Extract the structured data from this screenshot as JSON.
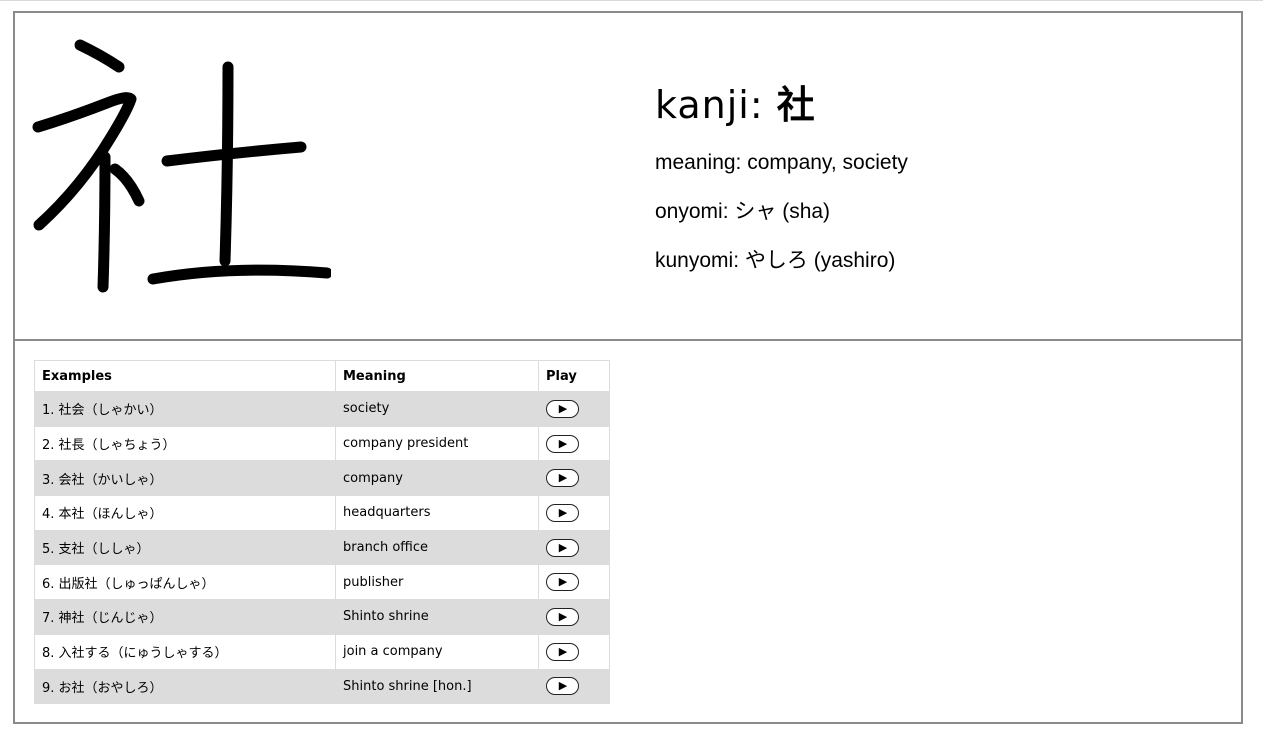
{
  "kanji": {
    "prefix": "kanji: ",
    "character": "社",
    "meaning_line": "meaning: company, society",
    "onyomi_line": "onyomi: シャ (sha)",
    "kunyomi_line": "kunyomi: やしろ (yashiro)"
  },
  "table": {
    "headers": {
      "examples": "Examples",
      "meaning": "Meaning",
      "play": "Play"
    },
    "play_icon": "▶",
    "rows": [
      {
        "example": "1. 社会（しゃかい）",
        "meaning": "society"
      },
      {
        "example": "2. 社長（しゃちょう）",
        "meaning": "company president"
      },
      {
        "example": "3. 会社（かいしゃ）",
        "meaning": "company"
      },
      {
        "example": "4. 本社（ほんしゃ）",
        "meaning": "headquarters"
      },
      {
        "example": "5. 支社（ししゃ）",
        "meaning": "branch office"
      },
      {
        "example": "6. 出版社（しゅっぱんしゃ）",
        "meaning": "publisher"
      },
      {
        "example": "7. 神社（じんじゃ）",
        "meaning": "Shinto shrine"
      },
      {
        "example": "8. 入社する（にゅうしゃする）",
        "meaning": "join a company"
      },
      {
        "example": "9. お社（おやしろ）",
        "meaning": "Shinto shrine [hon.]"
      }
    ]
  }
}
